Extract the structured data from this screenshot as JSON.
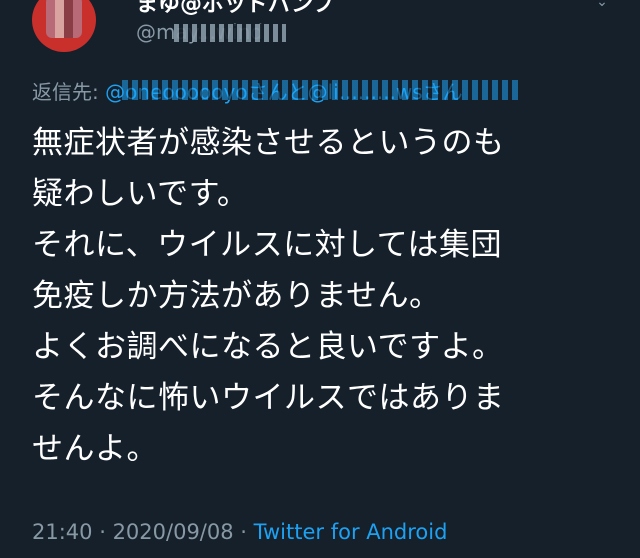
{
  "colors": {
    "background": "#15202b",
    "text": "#ffffff",
    "muted": "#8899a6",
    "accent": "#1da1f2"
  },
  "author": {
    "display_name": "まゆ@ポッドパンプ",
    "handle": "@may...wind"
  },
  "reply": {
    "label": "返信先: ",
    "targets": "@oneoooooyoさんと@li.........wsさん"
  },
  "tweet": {
    "lines": [
      "無症状者が感染させるというのも",
      "疑わしいです。",
      "それに、ウイルスに対しては集団",
      "免疫しか方法がありません。",
      "よくお調べになると良いですよ。",
      "そんなに怖いウイルスではありま",
      "せんよ。"
    ]
  },
  "meta": {
    "time": "21:40",
    "separator": " · ",
    "date": "2020/09/08",
    "separator2": " · ",
    "client": "Twitter for Android"
  },
  "icons": {
    "caret": "chevron-down-icon"
  }
}
